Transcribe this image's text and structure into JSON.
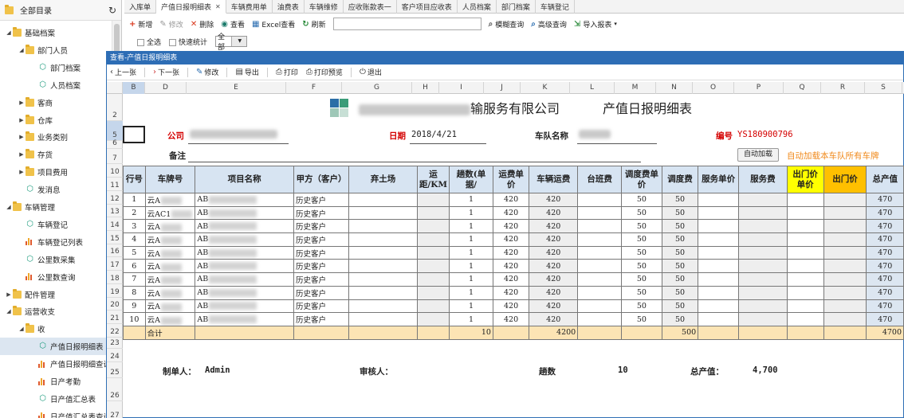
{
  "sidebar": {
    "title": "全部目录",
    "items": [
      {
        "label": "基础档案",
        "level": 0,
        "icon": "folder-icon",
        "expanded": true
      },
      {
        "label": "部门人员",
        "level": 1,
        "icon": "folder-icon",
        "expanded": true
      },
      {
        "label": "部门档案",
        "level": 2,
        "icon": "cube-icon"
      },
      {
        "label": "人员档案",
        "level": 2,
        "icon": "cube-icon"
      },
      {
        "label": "客商",
        "level": 1,
        "icon": "folder-icon",
        "expanded": false
      },
      {
        "label": "仓库",
        "level": 1,
        "icon": "folder-icon",
        "expanded": false
      },
      {
        "label": "业务类别",
        "level": 1,
        "icon": "folder-icon",
        "expanded": false
      },
      {
        "label": "存货",
        "level": 1,
        "icon": "folder-icon",
        "expanded": false
      },
      {
        "label": "项目费用",
        "level": 1,
        "icon": "folder-icon",
        "expanded": false
      },
      {
        "label": "发消息",
        "level": 1,
        "icon": "cube-icon"
      },
      {
        "label": "车辆管理",
        "level": 0,
        "icon": "folder-icon",
        "expanded": true
      },
      {
        "label": "车辆登记",
        "level": 1,
        "icon": "cube-icon"
      },
      {
        "label": "车辆登记列表",
        "level": 1,
        "icon": "bar-chart-icon"
      },
      {
        "label": "公里数采集",
        "level": 1,
        "icon": "cube-icon"
      },
      {
        "label": "公里数查询",
        "level": 1,
        "icon": "bar-chart-icon"
      },
      {
        "label": "配件管理",
        "level": 0,
        "icon": "folder-icon",
        "expanded": false
      },
      {
        "label": "运营收支",
        "level": 0,
        "icon": "folder-icon",
        "expanded": true
      },
      {
        "label": "收",
        "level": 1,
        "icon": "folder-icon",
        "expanded": true
      },
      {
        "label": "产值日报明细表",
        "level": 2,
        "icon": "cube-icon",
        "selected": true
      },
      {
        "label": "产值日报明细查询",
        "level": 2,
        "icon": "bar-chart-icon"
      },
      {
        "label": "日产考勤",
        "level": 2,
        "icon": "bar-chart-icon"
      },
      {
        "label": "日产值汇总表",
        "level": 2,
        "icon": "cube-icon"
      },
      {
        "label": "日产值汇总表查询",
        "level": 2,
        "icon": "bar-chart-icon"
      }
    ]
  },
  "tabs": [
    "入库单",
    "产值日报明细表",
    "车辆费用单",
    "油费表",
    "车辆维修",
    "应收账款表一",
    "客户项目应收表",
    "人员档案",
    "部门档案",
    "车辆登记"
  ],
  "active_tab": 1,
  "toolbar": {
    "add": "新增",
    "edit": "修改",
    "delete": "删除",
    "view": "查看",
    "excel": "Excel查看",
    "refresh": "刷新",
    "fuzzy": "模糊查询",
    "advanced": "高级查询",
    "import": "导入报表"
  },
  "filter": {
    "select_all": "全选",
    "quick_stats": "快速统计",
    "scope": "全部"
  },
  "dialog": {
    "title": "查看-产值日报明细表",
    "tools": {
      "prev": "上一张",
      "next": "下一张",
      "edit": "修改",
      "export": "导出",
      "print": "打印",
      "preview": "打印预览",
      "exit": "退出"
    }
  },
  "sheet": {
    "columns": [
      "B",
      "D",
      "E",
      "F",
      "G",
      "H",
      "I",
      "J",
      "K",
      "L",
      "M",
      "N",
      "O",
      "P",
      "Q",
      "R",
      "S"
    ],
    "rows": [
      "2",
      "5",
      "6",
      "7",
      "10",
      "11",
      "12",
      "13",
      "14",
      "15",
      "16",
      "17",
      "18",
      "19",
      "20",
      "21",
      "22",
      "23",
      "24",
      "25",
      "26",
      "27"
    ]
  },
  "report": {
    "company_suffix": "输服务有限公司",
    "title": "产值日报明细表",
    "company_label": "公司",
    "date_label": "日期",
    "date_value": "2018/4/21",
    "team_label": "车队名称",
    "number_label": "编号",
    "number_value": "YS180900796",
    "remark_label": "备注",
    "auto_load_button": "自动加载",
    "auto_load_note": "自动加载本车队所有车牌",
    "headers": [
      "行号",
      "车牌号",
      "项目名称",
      "甲方（客户）",
      "弃土场",
      "运距/KM",
      "趟数(单据/",
      "运费单价",
      "车辆运费",
      "台班费",
      "调度费单价",
      "调度费",
      "服务单价",
      "服务费",
      "出门价单价",
      "出门价",
      "总产值"
    ],
    "rows": [
      {
        "no": "1",
        "plate": "云A",
        "project": "AB",
        "client": "历史客户",
        "trips": "1",
        "unit": "420",
        "freight": "420",
        "disp_unit": "50",
        "disp": "50",
        "total": "470"
      },
      {
        "no": "2",
        "plate": "云AC1",
        "project": "AB",
        "client": "历史客户",
        "trips": "1",
        "unit": "420",
        "freight": "420",
        "disp_unit": "50",
        "disp": "50",
        "total": "470"
      },
      {
        "no": "3",
        "plate": "云A",
        "project": "AB",
        "client": "历史客户",
        "trips": "1",
        "unit": "420",
        "freight": "420",
        "disp_unit": "50",
        "disp": "50",
        "total": "470"
      },
      {
        "no": "4",
        "plate": "云A",
        "project": "AB",
        "client": "历史客户",
        "trips": "1",
        "unit": "420",
        "freight": "420",
        "disp_unit": "50",
        "disp": "50",
        "total": "470"
      },
      {
        "no": "5",
        "plate": "云A",
        "project": "AB",
        "client": "历史客户",
        "trips": "1",
        "unit": "420",
        "freight": "420",
        "disp_unit": "50",
        "disp": "50",
        "total": "470"
      },
      {
        "no": "6",
        "plate": "云A",
        "project": "AB",
        "client": "历史客户",
        "trips": "1",
        "unit": "420",
        "freight": "420",
        "disp_unit": "50",
        "disp": "50",
        "total": "470"
      },
      {
        "no": "7",
        "plate": "云A",
        "project": "AB",
        "client": "历史客户",
        "trips": "1",
        "unit": "420",
        "freight": "420",
        "disp_unit": "50",
        "disp": "50",
        "total": "470"
      },
      {
        "no": "8",
        "plate": "云A",
        "project": "AB",
        "client": "历史客户",
        "trips": "1",
        "unit": "420",
        "freight": "420",
        "disp_unit": "50",
        "disp": "50",
        "total": "470"
      },
      {
        "no": "9",
        "plate": "云A",
        "project": "AB",
        "client": "历史客户",
        "trips": "1",
        "unit": "420",
        "freight": "420",
        "disp_unit": "50",
        "disp": "50",
        "total": "470"
      },
      {
        "no": "10",
        "plate": "云A",
        "project": "AB",
        "client": "历史客户",
        "trips": "1",
        "unit": "420",
        "freight": "420",
        "disp_unit": "50",
        "disp": "50",
        "total": "470"
      }
    ],
    "total_row": {
      "label": "合计",
      "trips": "10",
      "freight": "4200",
      "disp": "500",
      "total": "4700"
    },
    "footer": {
      "maker_label": "制单人：",
      "maker_value": "Admin",
      "reviewer_label": "审核人：",
      "trips_label": "趟数",
      "trips_value": "10",
      "output_label": "总产值：",
      "output_value": "4,700"
    }
  }
}
